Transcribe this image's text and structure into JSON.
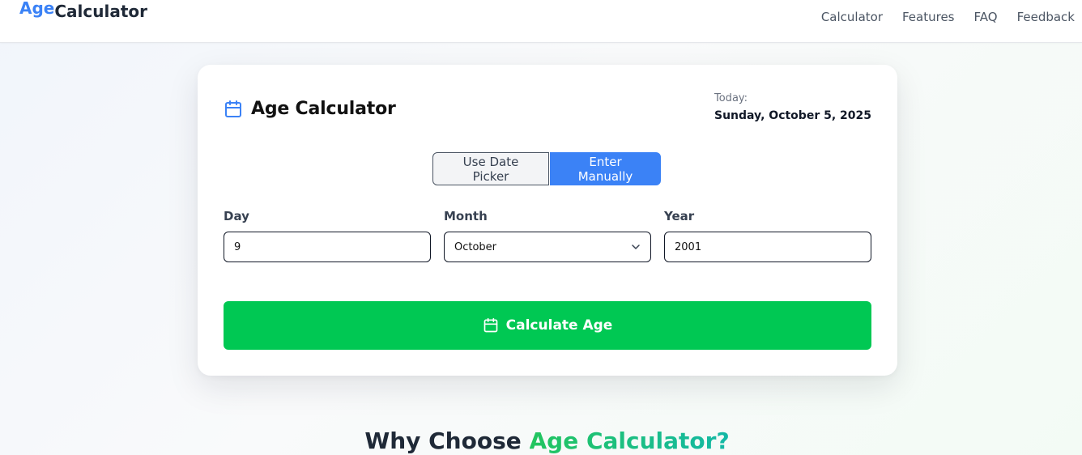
{
  "header": {
    "logo_part1": "Age",
    "logo_part2": "Calculator",
    "nav": [
      "Calculator",
      "Features",
      "FAQ",
      "Feedback"
    ]
  },
  "card": {
    "title": "Age Calculator",
    "title_icon": "calendar-icon",
    "today_label": "Today:",
    "today_date": "Sunday, October 5, 2025",
    "mode_toggle": {
      "date_picker_label": "Use Date Picker",
      "manual_label": "Enter Manually",
      "selected": "Enter Manually"
    },
    "fields": {
      "day": {
        "label": "Day",
        "value": "9"
      },
      "month": {
        "label": "Month",
        "value": "October"
      },
      "year": {
        "label": "Year",
        "value": "2001"
      }
    },
    "calculate_label": "Calculate Age",
    "calculate_icon": "calendar-icon"
  },
  "section": {
    "heading_prefix": "Why Choose ",
    "heading_accent": "Age Calculator?"
  },
  "colors": {
    "accent_blue": "#3b82f6",
    "calculate_green": "#00c853",
    "text_dark": "#1f2937"
  }
}
